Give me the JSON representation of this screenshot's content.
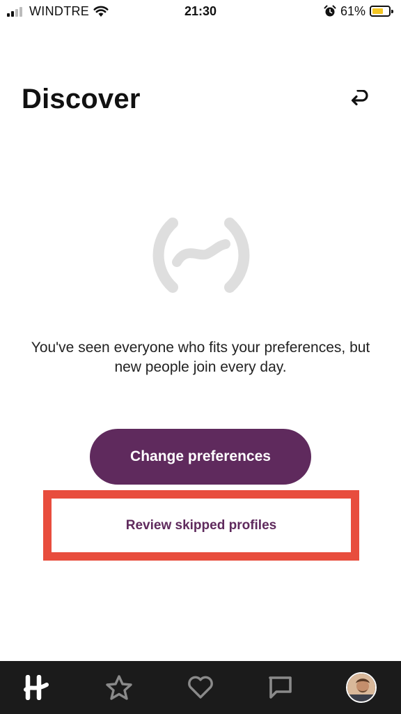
{
  "status_bar": {
    "carrier": "WINDTRE",
    "time": "21:30",
    "battery_percent": "61%",
    "battery_level": 0.61,
    "battery_color": "#f3c623",
    "icons": [
      "signal-icon",
      "wifi-icon",
      "alarm-icon",
      "battery-icon"
    ]
  },
  "header": {
    "title": "Discover",
    "undo_icon": "undo-icon"
  },
  "empty_state": {
    "logo_icon": "hinge-empty-logo-icon",
    "message": "You've seen everyone who fits your preferences, but new people join every day."
  },
  "actions": {
    "primary_label": "Change preferences",
    "secondary_label": "Review skipped profiles",
    "accent_color": "#5f2a5d",
    "highlight_color": "#e84d3d"
  },
  "tab_bar": {
    "tabs": [
      {
        "name": "discover",
        "icon": "hinge-h-icon",
        "active": true
      },
      {
        "name": "standouts",
        "icon": "star-icon",
        "active": false
      },
      {
        "name": "likes-you",
        "icon": "heart-icon",
        "active": false
      },
      {
        "name": "matches",
        "icon": "chat-bubble-icon",
        "active": false
      },
      {
        "name": "profile",
        "icon": "avatar",
        "active": false
      }
    ]
  }
}
